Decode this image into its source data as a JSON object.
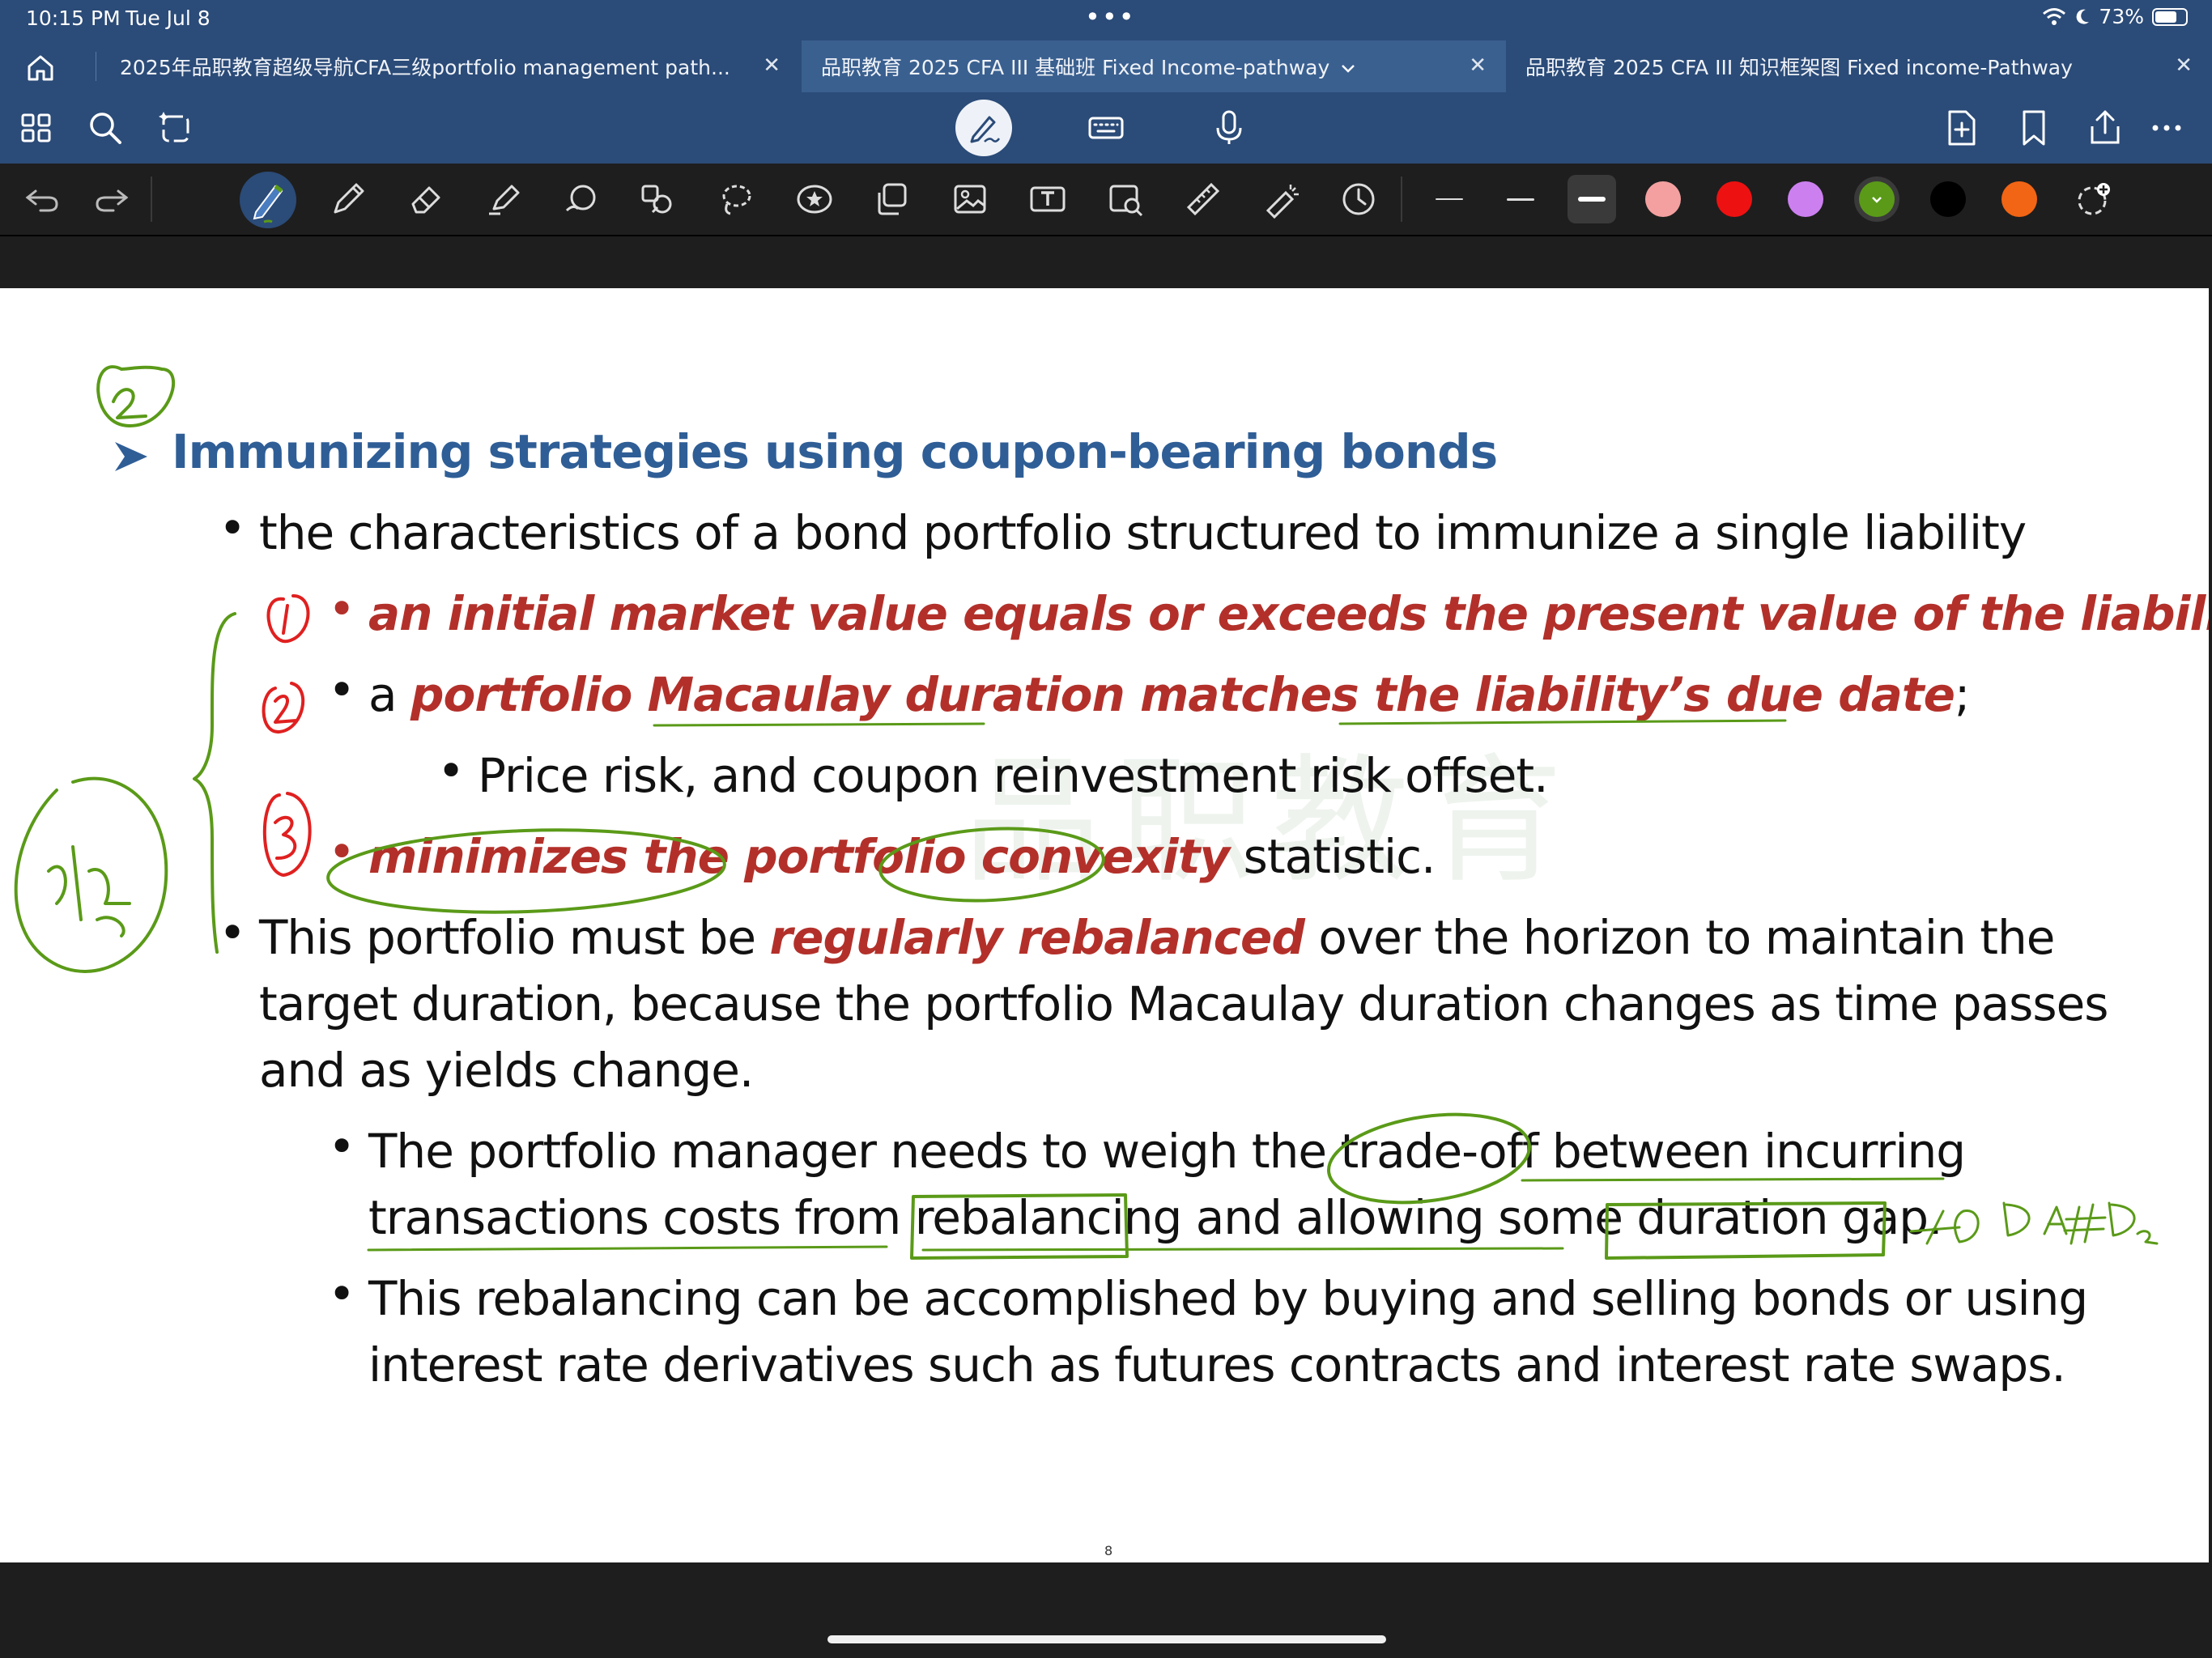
{
  "status": {
    "time": "10:15 PM",
    "date": "Tue Jul 8",
    "battery": "73%",
    "battery_level": 0.73
  },
  "tabs": [
    {
      "label": "2025年品职教育超级导航CFA三级portfolio management path...",
      "active": false
    },
    {
      "label": "品职教育 2025 CFA III 基础班 Fixed Income-pathway",
      "active": true
    },
    {
      "label": "品职教育 2025 CFA III 知识框架图 Fixed income-Pathway",
      "active": false
    }
  ],
  "colors": {
    "chrome": "#2b4b78",
    "title": "#2f5e96",
    "emphasis": "#b3302a",
    "ink_green": "#5a9a18",
    "ink_red": "#e02020",
    "swatches": [
      "#f4a0a0",
      "#ee1111",
      "#cc80f0",
      "#5a9a18",
      "#000000",
      "#f26514"
    ]
  },
  "slide": {
    "title": "Immunizing strategies using coupon-bearing bonds",
    "b1": "the characteristics of a bond portfolio structured to immunize a single liability",
    "s1": "an initial market value equals or exceeds the present value of the liability",
    "s1_end": ";",
    "s2_a": "a ",
    "s2_b": "portfolio Macaulay duration matches the liability’s due date",
    "s2_end": ";",
    "ss1": "Price risk, and coupon reinvestment risk offset.",
    "s3": "minimizes the portfolio convexity",
    "s3_end": " statistic.",
    "b2_a": "This portfolio must be ",
    "b2_b": "regularly rebalanced",
    "b2_c": " over the horizon to maintain the",
    "b2_line2": "target duration, because the portfolio Macaulay duration changes as time passes",
    "b2_line3": "and as yields change.",
    "s4_line1": "The portfolio manager needs to weigh the trade-off between incurring",
    "s4_line2": "transactions costs from rebalancing and allowing some duration gap.",
    "s5_line1": "This rebalancing can be accomplished by buying and selling bonds or using",
    "s5_line2": "interest rate derivatives such as futures contracts and interest rate swaps.",
    "page_number": "8",
    "watermark": "品职教育"
  }
}
